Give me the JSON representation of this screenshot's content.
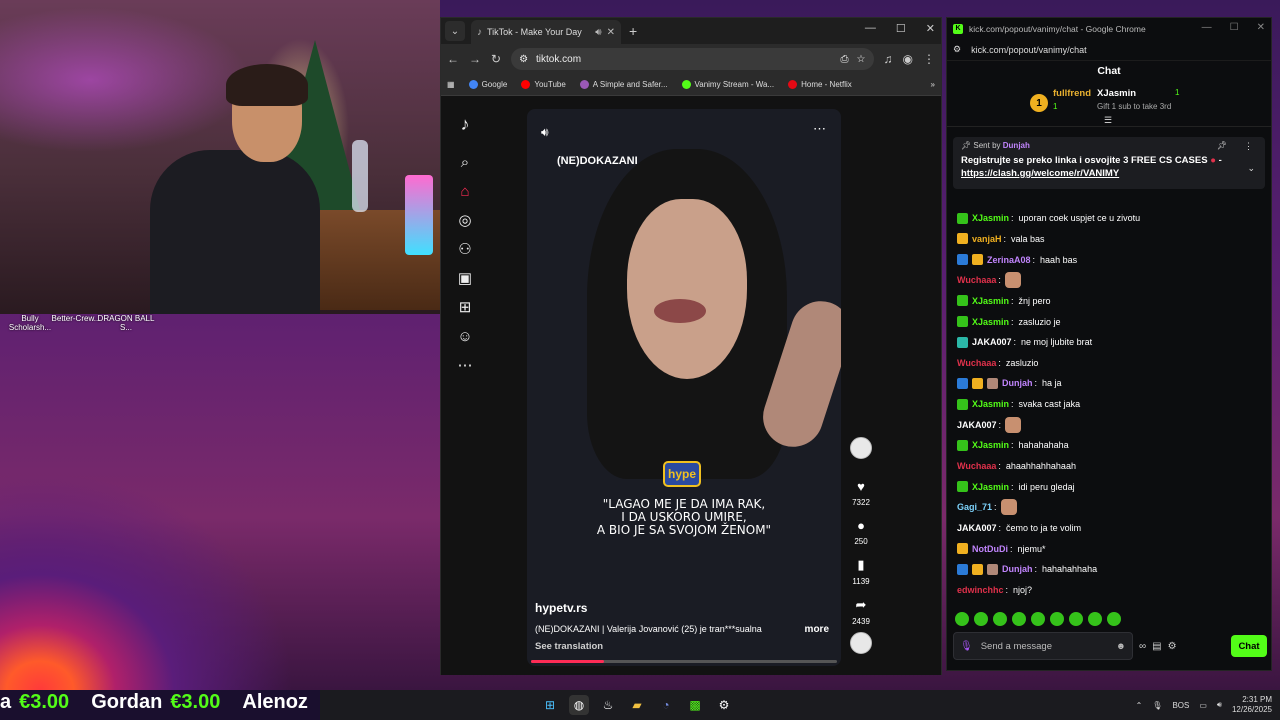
{
  "desktop": {
    "icons": [
      {
        "label": "Bully Scholarsh..."
      },
      {
        "label": "Better-Crew..."
      },
      {
        "label": "DRAGON BALL S..."
      }
    ]
  },
  "tiktok_window": {
    "tab_title": "TikTok - Make Your Day",
    "url": "tiktok.com",
    "bookmarks": [
      {
        "label": "Google",
        "color": "#4285f4"
      },
      {
        "label": "YouTube",
        "color": "#ff0000"
      },
      {
        "label": "A Simple and Safer...",
        "color": "#9b59b6"
      },
      {
        "label": "Vanimy Stream - Wa...",
        "color": "#53fc18"
      },
      {
        "label": "Home - Netflix",
        "color": "#e50914"
      }
    ],
    "video": {
      "watermark": "(NE)DOKAZANI",
      "logo_text": "hype",
      "caption": "\"LAGAO ME JE DA IMA RAK,\nI DA USKORO UMIRE,\nA BIO JE SA SVOJOM ŽENOM\"",
      "author": "hypetv.rs",
      "description": "(NE)DOKAZANI | Valerija Jovanović (25) je tran***sualna",
      "more_label": "more",
      "see_translation": "See translation",
      "progress_fraction": 0.24
    },
    "actions": [
      {
        "icon": "heart-icon",
        "count": "7322"
      },
      {
        "icon": "comment-icon",
        "count": "250"
      },
      {
        "icon": "bookmark-icon",
        "count": "1139"
      },
      {
        "icon": "share-icon",
        "count": "2439"
      }
    ],
    "accent": "#fe2c55"
  },
  "kick_window": {
    "title": "kick.com/popout/vanimy/chat - Google Chrome",
    "url": "kick.com/popout/vanimy/chat",
    "chat_title": "Chat",
    "leaderboard": {
      "rank": "1",
      "first_name": "fullfrend",
      "first_count": "1",
      "second_name": "XJasmin",
      "second_count": "1",
      "gift_text": "Gift 1 sub to take 3rd"
    },
    "pinned": {
      "sent_by": "Sent by",
      "sender": "Dunjah",
      "message": "Registrujte se preko linka i osvojite 3 FREE CS CASES",
      "dash": "-",
      "link": "https://clash.gg/welcome/r/VANIMY"
    },
    "messages": [
      {
        "user": "XJasmin",
        "color": "#53fc18",
        "text": "uporan coek uspjet ce u zivotu",
        "badges": [
          "#35c21a"
        ],
        "emote": false
      },
      {
        "user": "vanjaH",
        "color": "#f0b020",
        "text": "vala bas",
        "badges": [
          "#f0b020"
        ],
        "emote": false
      },
      {
        "user": "ZerinaA08",
        "color": "#c084fc",
        "text": "haah bas",
        "badges": [
          "#2b7bd8",
          "#f0b020"
        ],
        "emote": false
      },
      {
        "user": "Wuchaaa",
        "color": "#e0314b",
        "text": "",
        "badges": [],
        "emote": true
      },
      {
        "user": "XJasmin",
        "color": "#53fc18",
        "text": "žnj pero",
        "badges": [
          "#35c21a"
        ],
        "emote": false
      },
      {
        "user": "XJasmin",
        "color": "#53fc18",
        "text": "zasluzio je",
        "badges": [
          "#35c21a"
        ],
        "emote": false
      },
      {
        "user": "JAKA007",
        "color": "#ffffff",
        "text": "ne moj ljubite brat",
        "badges": [
          "#2bb8a8"
        ],
        "emote": false
      },
      {
        "user": "Wuchaaa",
        "color": "#e0314b",
        "text": "zasluzio",
        "badges": [],
        "emote": false
      },
      {
        "user": "Dunjah",
        "color": "#c084fc",
        "text": "ha ja",
        "badges": [
          "#2b7bd8",
          "#f0b020",
          "#b08878"
        ],
        "emote": false
      },
      {
        "user": "XJasmin",
        "color": "#53fc18",
        "text": "svaka cast jaka",
        "badges": [
          "#35c21a"
        ],
        "emote": false
      },
      {
        "user": "JAKA007",
        "color": "#ffffff",
        "text": "",
        "badges": [],
        "emote": true
      },
      {
        "user": "XJasmin",
        "color": "#53fc18",
        "text": "hahahahaha",
        "badges": [
          "#35c21a"
        ],
        "emote": false
      },
      {
        "user": "Wuchaaa",
        "color": "#e0314b",
        "text": "ahaahhahhahaah",
        "badges": [],
        "emote": false
      },
      {
        "user": "XJasmin",
        "color": "#53fc18",
        "text": "idi peru gledaj",
        "badges": [
          "#35c21a"
        ],
        "emote": false
      },
      {
        "user": "Gagi_71",
        "color": "#7dd3fc",
        "text": "",
        "badges": [],
        "emote": true
      },
      {
        "user": "JAKA007",
        "color": "#ffffff",
        "text": "čemo to ja te volim",
        "badges": [],
        "emote": false
      },
      {
        "user": "NotDuDi",
        "color": "#c084fc",
        "text": "njemu*",
        "badges": [
          "#f0b020"
        ],
        "emote": false
      },
      {
        "user": "Dunjah",
        "color": "#c084fc",
        "text": "hahahahhaha",
        "badges": [
          "#2b7bd8",
          "#f0b020",
          "#b08878"
        ],
        "emote": false
      },
      {
        "user": "edwinchhc",
        "color": "#e0314b",
        "text": "njoj?",
        "badges": [],
        "emote": false
      }
    ],
    "input_placeholder": "Send a message",
    "chat_button": "Chat",
    "accent": "#53fc18"
  },
  "ticker": [
    {
      "name": "a",
      "amount": "€3.00"
    },
    {
      "name": "Gordan",
      "amount": "€3.00"
    },
    {
      "name": "Alenoz",
      "amount": ""
    }
  ],
  "taskbar": {
    "language": "BOS",
    "time": "2:31 PM",
    "date": "12/26/2025"
  }
}
